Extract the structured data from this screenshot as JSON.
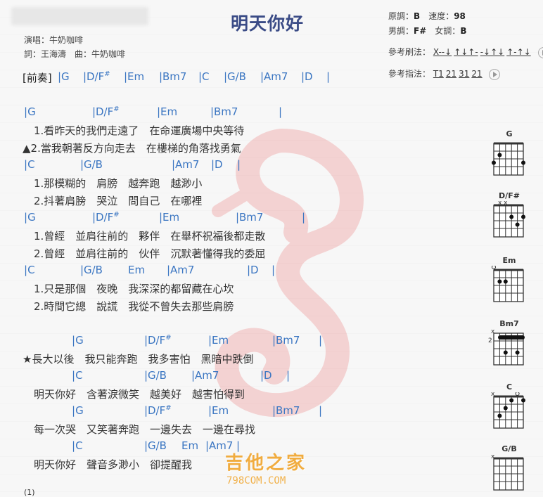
{
  "song": {
    "title": "明天你好",
    "singer": "演唱：牛奶咖啡",
    "credits": "詞：王海濤　曲：牛奶咖啡"
  },
  "info": {
    "orig_key_label": "原調：",
    "orig_key": "B",
    "tempo_label": "速度：",
    "tempo": "98",
    "male_key_label": "男調：",
    "male_key": "F#",
    "female_key_label": "女調：",
    "female_key": "B",
    "strum_label": "參考刷法：",
    "strums": [
      "X--↓",
      "↑↓↑-",
      "-↓↑↓",
      "↑-↑↓"
    ],
    "finger_label": "參考指法：",
    "fingers": [
      "T1",
      "21",
      "31",
      "21"
    ]
  },
  "intro": {
    "label": "[前奏]",
    "chords": [
      "G",
      "D/F#",
      "Em",
      "Bm7",
      "C",
      "G/B",
      "Am7",
      "D"
    ]
  },
  "lyrics": [
    {
      "chords": [
        "G",
        "D/F#",
        "Em",
        "Bm7"
      ]
    },
    {
      "text": "1.看昨天的我們走遠了　在命運廣場中央等待"
    },
    {
      "text": "▲2.當我朝著反方向走去　在樓梯的角落找勇氣"
    },
    {
      "chords": [
        "C",
        "G/B",
        "Am7",
        "D"
      ]
    },
    {
      "text": "1.那模糊的　肩膀　越奔跑　越渺小"
    },
    {
      "text": "2.抖著肩膀　哭泣　問自己　在哪裡"
    },
    {
      "chords": [
        "G",
        "D/F#",
        "Em",
        "Bm7"
      ]
    },
    {
      "text": "1.曾經　並肩往前的　夥伴　在舉杯祝福後都走散"
    },
    {
      "text": "2.曾經　並肩往前的　伙伴　沉默著懂得我的委屈"
    },
    {
      "chords": [
        "C",
        "G/B",
        "Em",
        "Am7",
        "D"
      ]
    },
    {
      "text": "1.只是那個　夜晚　我深深的都留藏在心坎"
    },
    {
      "text": "2.時間它總　說謊　我從不曾失去那些肩膀"
    },
    {
      "chords": [
        "G",
        "D/F#",
        "Em",
        "Bm7"
      ]
    },
    {
      "text": "★長大以後　我只能奔跑　我多害怕　黑暗中跌倒"
    },
    {
      "chords": [
        "C",
        "G/B",
        "Am7",
        "D"
      ]
    },
    {
      "text": "明天你好　含著淚微笑　越美好　越害怕得到"
    },
    {
      "chords": [
        "G",
        "D/F#",
        "Em",
        "Bm7"
      ]
    },
    {
      "text": "每一次哭　又笑著奔跑　一邊失去　一邊在尋找"
    },
    {
      "chords": [
        "C",
        "G/B",
        "Em",
        "Am7"
      ]
    },
    {
      "text": "明天你好　聲音多渺小　卻提醒我"
    },
    {
      "text": "(1)"
    }
  ],
  "diagrams": [
    {
      "name": "G"
    },
    {
      "name": "D/F#",
      "top": "x x"
    },
    {
      "name": "Em"
    },
    {
      "name": "Bm7",
      "fret": "2",
      "top": "x"
    },
    {
      "name": "C",
      "top": "x"
    },
    {
      "name": "G/B",
      "top": "x"
    }
  ],
  "watermark": {
    "logo": "吉他之家",
    "site": "798COM.COM"
  }
}
